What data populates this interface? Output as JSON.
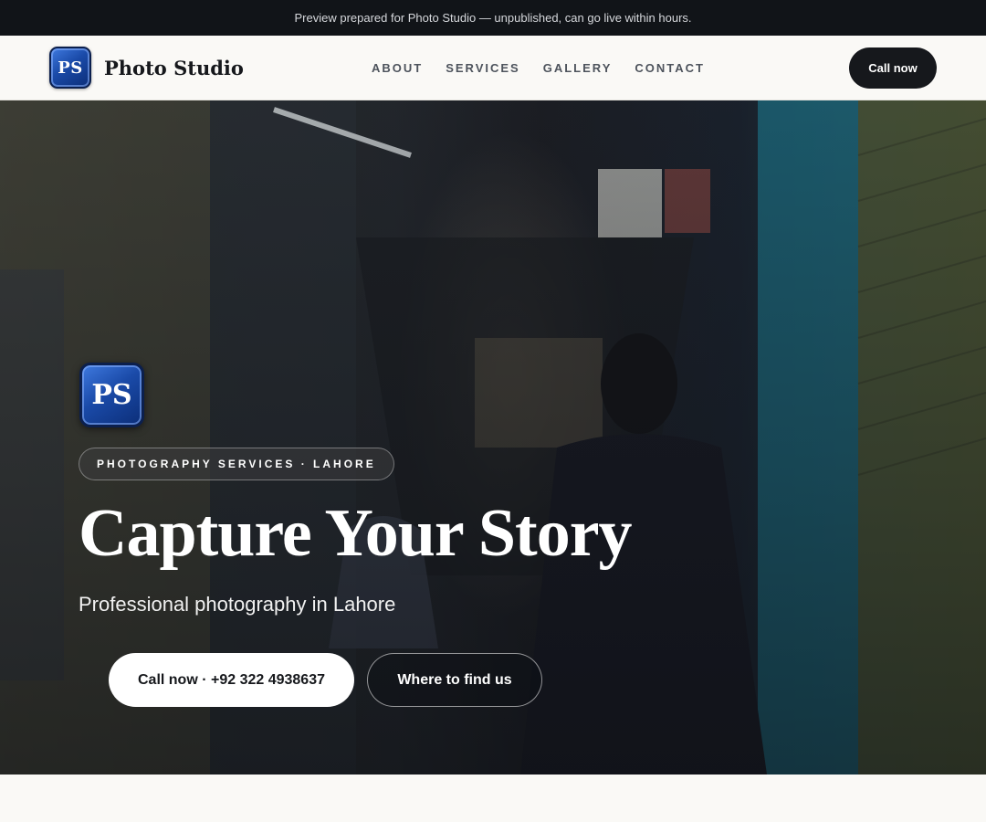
{
  "preview_bar": {
    "text": "Preview prepared for Photo Studio — unpublished, can go live within hours."
  },
  "brand": {
    "logo_text": "PS",
    "name": "Photo Studio"
  },
  "nav": {
    "links": [
      "ABOUT",
      "SERVICES",
      "GALLERY",
      "CONTACT"
    ],
    "cta_label": "Call now"
  },
  "hero": {
    "logo_text": "PS",
    "badge": "PHOTOGRAPHY SERVICES · LAHORE",
    "title": "Capture Your Story",
    "subtitle": "Professional photography in Lahore",
    "primary_button": "Call now · +92 322 4938637",
    "secondary_button": "Where to find us"
  },
  "colors": {
    "preview_bar_bg": "#111418",
    "nav_bg": "#faf9f6",
    "brand_blue": "#1a4aa8",
    "dark_button": "#16181c"
  }
}
